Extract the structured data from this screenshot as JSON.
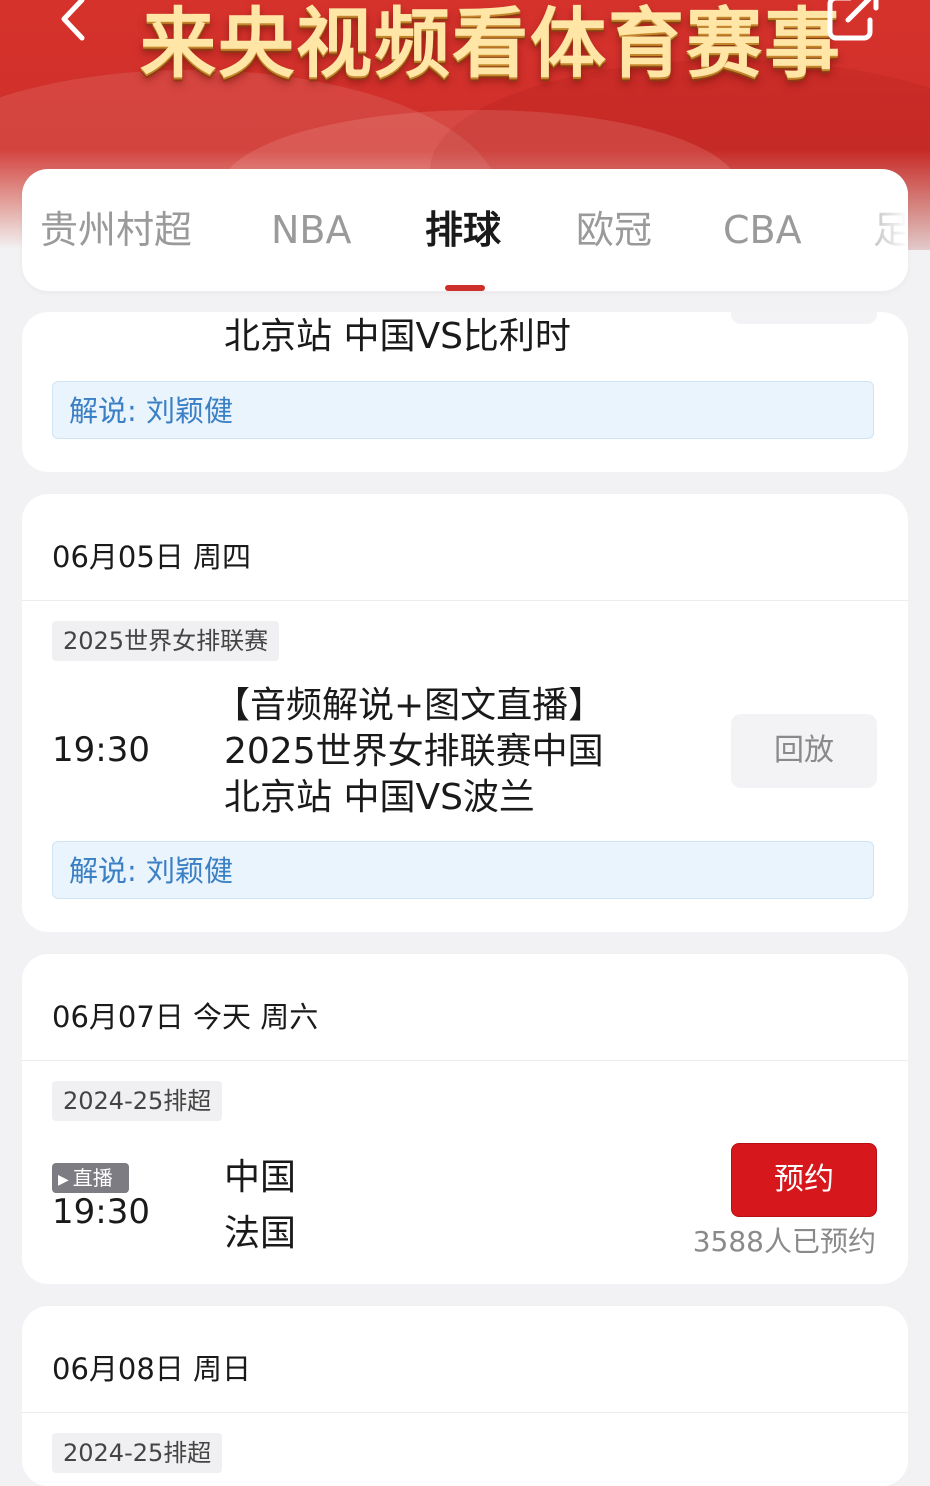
{
  "header": {
    "title": "来央视频看体育赛事",
    "back_icon": "chevron-left-icon",
    "share_icon": "share-icon",
    "brand_color": "#cf2f2a"
  },
  "tabs": [
    {
      "label": "贵州村超",
      "active": false
    },
    {
      "label": "NBA",
      "active": false
    },
    {
      "label": "排球",
      "active": true
    },
    {
      "label": "欧冠",
      "active": false
    },
    {
      "label": "CBA",
      "active": false
    },
    {
      "label": "足",
      "active": false
    }
  ],
  "cards": [
    {
      "title_lines": [
        "北京站 中国VS比利时"
      ],
      "commentary": "解说: 刘颖健"
    },
    {
      "date": "06月05日 周四",
      "league": "2025世界女排联赛",
      "time": "19:30",
      "title_lines": [
        "【音频解说+图文直播】",
        "2025世界女排联赛中国",
        "北京站 中国VS波兰"
      ],
      "action": "回放",
      "commentary": "解说: 刘颖健"
    },
    {
      "date": "06月07日 今天 周六",
      "league": "2024-25排超",
      "live_badge": "直播",
      "time": "19:30",
      "teams": [
        "中国",
        "法国"
      ],
      "action": "预约",
      "reserve_count": "3588人已预约"
    },
    {
      "date": "06月08日 周日",
      "league": "2024-25排超"
    }
  ]
}
